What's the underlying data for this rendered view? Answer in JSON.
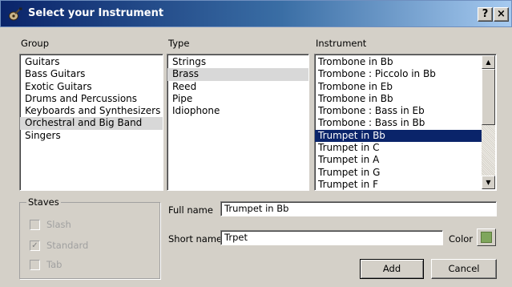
{
  "window": {
    "title": "Select your Instrument",
    "help_glyph": "?",
    "close_glyph": "×"
  },
  "group": {
    "label": "Group",
    "items": [
      "Guitars",
      "Bass Guitars",
      "Exotic Guitars",
      "Drums and Percussions",
      "Keyboards and Synthesizers",
      "Orchestral and Big Band",
      "Singers"
    ],
    "selected": "Orchestral and Big Band"
  },
  "type": {
    "label": "Type",
    "items": [
      "Strings",
      "Brass",
      "Reed",
      "Pipe",
      "Idiophone"
    ],
    "selected": "Brass"
  },
  "instrument": {
    "label": "Instrument",
    "items": [
      "Trombone in Bb",
      "Trombone : Piccolo in Bb",
      "Trombone in Eb",
      "Trombone in Bb",
      "Trombone : Bass in Eb",
      "Trombone : Bass in Bb",
      "Trumpet in Bb",
      "Trumpet in C",
      "Trumpet in A",
      "Trumpet in G",
      "Trumpet in F"
    ],
    "selected": "Trumpet in Bb"
  },
  "staves": {
    "legend": "Staves",
    "options": [
      {
        "label": "Slash",
        "checked": false
      },
      {
        "label": "Standard",
        "checked": true
      },
      {
        "label": "Tab",
        "checked": false
      }
    ]
  },
  "fields": {
    "full_name_label": "Full name",
    "full_name_value": "Trumpet in Bb",
    "short_name_label": "Short name",
    "short_name_value": "Trpet",
    "color_label": "Color",
    "color_value": "#7fa65c"
  },
  "buttons": {
    "add": "Add",
    "cancel": "Cancel"
  }
}
